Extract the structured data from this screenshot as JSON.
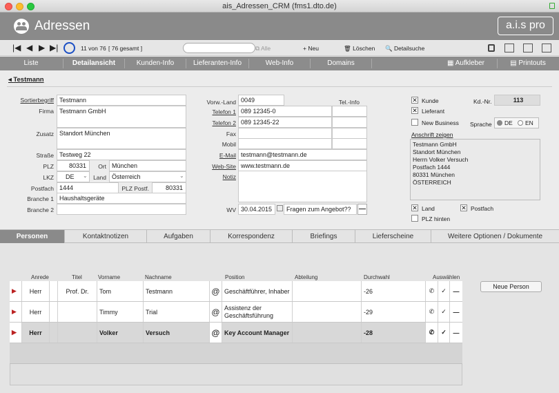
{
  "window": {
    "title": "ais_Adressen_CRM (fms1.dto.de)"
  },
  "header": {
    "title": "Adressen",
    "logo": "a.i.s pro"
  },
  "toolbar": {
    "record_info": "11 von 76",
    "total": "[ 76 gesamt ]",
    "search_placeholder": "",
    "all_label": "Alle",
    "new_label": "Neu",
    "delete_label": "Löschen",
    "detail_search_label": "Detailsuche"
  },
  "nav": {
    "items": [
      "Liste",
      "Detailansicht",
      "Kunden-Info",
      "Lieferanten-Info",
      "Web-Info",
      "Domains",
      "Aufkleber",
      "Printouts"
    ]
  },
  "breadcrumb": {
    "label": "Testmann"
  },
  "form": {
    "labels": {
      "sortierbegriff": "Sortierbegriff",
      "firma": "Firma",
      "zusatz": "Zusatz",
      "strasse": "Straße",
      "plz": "PLZ",
      "ort": "Ort",
      "lkz": "LKZ",
      "land": "Land",
      "postfach": "Postfach",
      "plz_postf": "PLZ Postf.",
      "branche1": "Branche 1",
      "branche2": "Branche 2",
      "vorw_land": "Vorw.-Land",
      "tel_info": "Tel.-Info",
      "telefon1": "Telefon 1",
      "telefon2": "Telefon 2",
      "fax": "Fax",
      "mobil": "Mobil",
      "email": "E-Mail",
      "website": "Web-Site",
      "notiz": "Notiz",
      "wv": "WV",
      "kd_nr": "Kd.-Nr.",
      "sprache": "Sprache",
      "anschrift": "Anschrift zeigen"
    },
    "values": {
      "sortierbegriff": "Testmann",
      "firma": "Testmann GmbH",
      "zusatz": "Standort München",
      "strasse": "Testweg 22",
      "plz": "80331",
      "ort": "München",
      "lkz": "DE",
      "land": "Österreich",
      "postfach": "1444",
      "plz_postf": "80331",
      "branche1": "Haushaltsgeräte",
      "branche2": "",
      "vorw_land": "0049",
      "telefon1": "089 12345-0",
      "telefon2": "089 12345-22",
      "fax": "",
      "mobil": "",
      "email": "testmann@testmann.de",
      "website": "www.testmann.de",
      "notiz": "",
      "wv_date": "30.04.2015",
      "wv_text": "Fragen zum Angebot??",
      "kd_nr": "113"
    },
    "checkboxes": {
      "kunde": {
        "label": "Kunde",
        "checked": true
      },
      "lieferant": {
        "label": "Lieferant",
        "checked": true
      },
      "new_business": {
        "label": "New Business",
        "checked": false
      },
      "land": {
        "label": "Land",
        "checked": true
      },
      "postfach": {
        "label": "Postfach",
        "checked": true
      },
      "plz_hinten": {
        "label": "PLZ hinten",
        "checked": false
      }
    },
    "sprache": {
      "options": [
        "DE",
        "EN"
      ],
      "selected": "DE"
    },
    "anschrift_lines": [
      "Testmann GmbH",
      "Standort München",
      "Herrn Volker Versuch",
      "Postfach 1444",
      "80331 München",
      "ÖSTERREICH"
    ]
  },
  "tabs": [
    "Personen",
    "Kontaktnotizen",
    "Aufgaben",
    "Korrespondenz",
    "Briefings",
    "Lieferscheine",
    "Weitere Optionen / Dokumente"
  ],
  "persons": {
    "columns": [
      "Anrede",
      "Titel",
      "Vorname",
      "Nachname",
      "Position",
      "Abteilung",
      "Durchwahl",
      "Auswählen"
    ],
    "new_person_label": "Neue Person",
    "rows": [
      {
        "anrede": "Herr",
        "titel": "Prof. Dr.",
        "vorname": "Tom",
        "nachname": "Testmann",
        "position": "Geschäftführer, Inhaber",
        "abteilung": "",
        "durchwahl": "-26"
      },
      {
        "anrede": "Herr",
        "titel": "",
        "vorname": "Timmy",
        "nachname": "Trial",
        "position": "Assistenz der Geschäftsführung",
        "abteilung": "",
        "durchwahl": "-29"
      },
      {
        "anrede": "Herr",
        "titel": "",
        "vorname": "Volker",
        "nachname": "Versuch",
        "position": "Key Account Manager",
        "abteilung": "",
        "durchwahl": "-28"
      }
    ]
  }
}
